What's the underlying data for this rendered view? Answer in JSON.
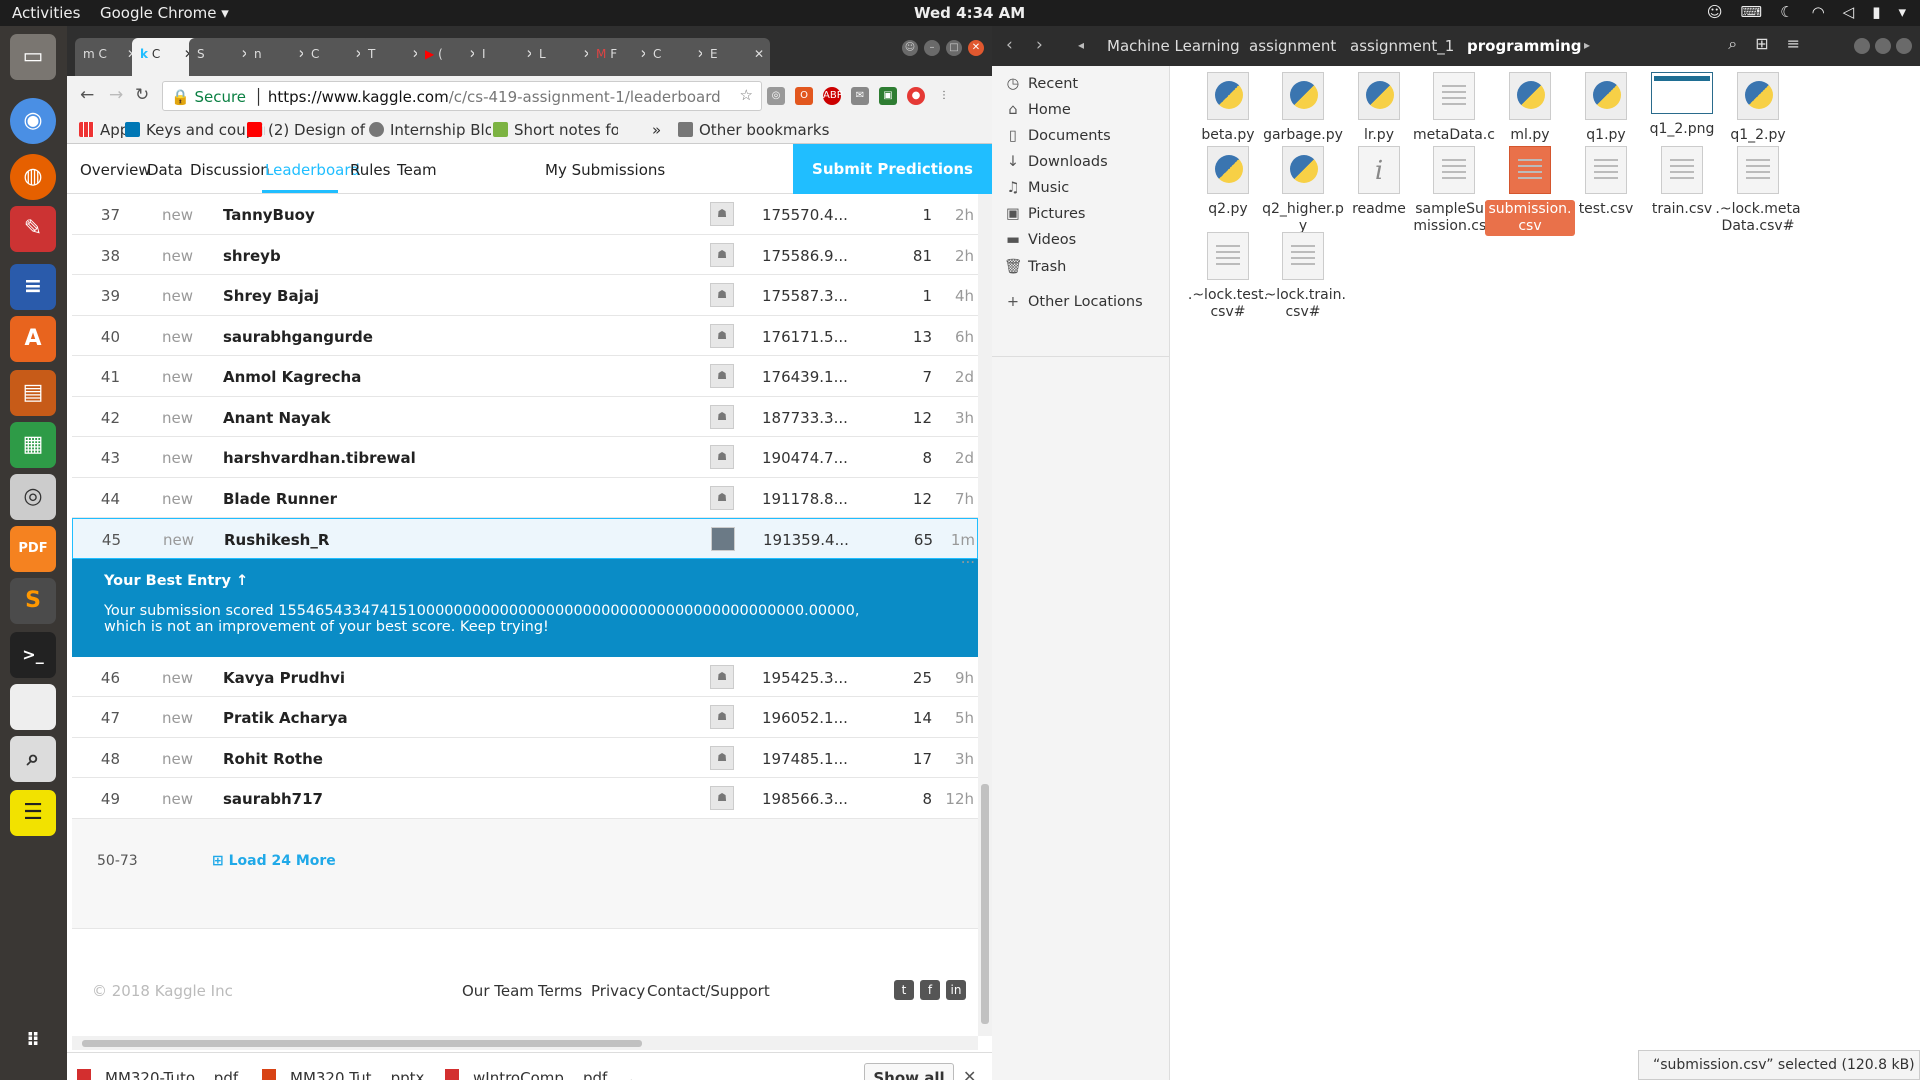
{
  "topbar": {
    "activities": "Activities",
    "app": "Google Chrome ▾",
    "clock": "Wed  4:34 AM"
  },
  "browser": {
    "tabs": [
      {
        "label": "C",
        "icon": "m"
      },
      {
        "label": "C",
        "icon": "k"
      },
      {
        "label": "S"
      },
      {
        "label": "n"
      },
      {
        "label": "C"
      },
      {
        "label": "T"
      },
      {
        "label": "("
      },
      {
        "label": "I"
      },
      {
        "label": "L"
      },
      {
        "label": "F"
      },
      {
        "label": "C"
      },
      {
        "label": "E"
      }
    ],
    "url": {
      "secure": "Secure",
      "host": "https://www.kaggle.com",
      "path": "/c/cs-419-assignment-1/leaderboard"
    },
    "bookmarks": [
      {
        "label": "Apps"
      },
      {
        "label": "Keys and couplin"
      },
      {
        "label": "(2) Design of Rig"
      },
      {
        "label": "Internship Blog -"
      },
      {
        "label": "Short notes for ("
      },
      {
        "label": "»"
      },
      {
        "label": "Other bookmarks"
      }
    ],
    "kaggle_nav": {
      "items": [
        "Overview",
        "Data",
        "Discussion",
        "Leaderboard",
        "Rules",
        "Team"
      ],
      "my_submissions": "My Submissions",
      "submit": "Submit Predictions"
    },
    "leaderboard_top": [
      {
        "rank": "37",
        "status": "new",
        "name": "TannyBuoy",
        "score": "175570.4...",
        "entries": "1",
        "last": "2h"
      },
      {
        "rank": "38",
        "status": "new",
        "name": "shreyb",
        "score": "175586.9...",
        "entries": "81",
        "last": "2h"
      },
      {
        "rank": "39",
        "status": "new",
        "name": "Shrey Bajaj",
        "score": "175587.3...",
        "entries": "1",
        "last": "4h"
      },
      {
        "rank": "40",
        "status": "new",
        "name": "saurabhgangurde",
        "score": "176171.5...",
        "entries": "13",
        "last": "6h"
      },
      {
        "rank": "41",
        "status": "new",
        "name": "Anmol Kagrecha",
        "score": "176439.1...",
        "entries": "7",
        "last": "2d"
      },
      {
        "rank": "42",
        "status": "new",
        "name": "Anant Nayak",
        "score": "187733.3...",
        "entries": "12",
        "last": "3h"
      },
      {
        "rank": "43",
        "status": "new",
        "name": "harshvardhan.tibrewal",
        "score": "190474.7...",
        "entries": "8",
        "last": "2d"
      },
      {
        "rank": "44",
        "status": "new",
        "name": "Blade Runner",
        "score": "191178.8...",
        "entries": "12",
        "last": "7h"
      }
    ],
    "my_row": {
      "rank": "45",
      "status": "new",
      "name": "Rushikesh_R",
      "score": "191359.4...",
      "entries": "65",
      "last": "1m ..."
    },
    "best_entry": {
      "title": "Your Best Entry ↑",
      "line1": "Your submission scored 155465433474151000000000000000000000000000000000000000000.00000,",
      "line2": "which is not an improvement of your best score. Keep trying!"
    },
    "leaderboard_bottom": [
      {
        "rank": "46",
        "status": "new",
        "name": "Kavya Prudhvi",
        "score": "195425.3...",
        "entries": "25",
        "last": "9h"
      },
      {
        "rank": "47",
        "status": "new",
        "name": "Pratik Acharya",
        "score": "196052.1...",
        "entries": "14",
        "last": "5h"
      },
      {
        "rank": "48",
        "status": "new",
        "name": "Rohit Rothe",
        "score": "197485.1...",
        "entries": "17",
        "last": "3h"
      },
      {
        "rank": "49",
        "status": "new",
        "name": "saurabh717",
        "score": "198566.3...",
        "entries": "8",
        "last": "12h"
      }
    ],
    "load_more": {
      "range": "50-73",
      "label": "Load 24 More"
    },
    "footer": {
      "copyright": "© 2018 Kaggle Inc",
      "links": [
        "Our Team",
        "Terms",
        "Privacy",
        "Contact/Support"
      ]
    },
    "downloads": [
      {
        "name": "MM320-Tuto....pdf"
      },
      {
        "name": "MM320 Tut....pptx"
      },
      {
        "name": "wIntroComp....pdf"
      }
    ],
    "show_all": "Show all"
  },
  "files": {
    "breadcrumbs": [
      "Machine Learning",
      "assignment",
      "assignment_1",
      "programming"
    ],
    "sidebar": [
      {
        "label": "Recent",
        "icon": "◷"
      },
      {
        "label": "Home",
        "icon": "⌂"
      },
      {
        "label": "Documents",
        "icon": "▯"
      },
      {
        "label": "Downloads",
        "icon": "↓"
      },
      {
        "label": "Music",
        "icon": "♫"
      },
      {
        "label": "Pictures",
        "icon": "▣"
      },
      {
        "label": "Videos",
        "icon": "▬"
      },
      {
        "label": "Trash",
        "icon": "🗑"
      },
      {
        "label": "Other Locations",
        "icon": "+"
      }
    ],
    "items": [
      {
        "name": "beta.py",
        "type": "py"
      },
      {
        "name": "garbage.py",
        "type": "py"
      },
      {
        "name": "lr.py",
        "type": "py"
      },
      {
        "name": "metaData.csv",
        "type": "doc"
      },
      {
        "name": "ml.py",
        "type": "py"
      },
      {
        "name": "q1.py",
        "type": "py"
      },
      {
        "name": "q1_2.png",
        "type": "png"
      },
      {
        "name": "q1_2.py",
        "type": "py"
      },
      {
        "name": "q2.py",
        "type": "py"
      },
      {
        "name": "q2_higher.py",
        "type": "py"
      },
      {
        "name": "readme",
        "type": "info"
      },
      {
        "name": "sampleSubmission.csv",
        "type": "doc"
      },
      {
        "name": "submission.csv",
        "type": "sel"
      },
      {
        "name": "test.csv",
        "type": "doc"
      },
      {
        "name": "train.csv",
        "type": "doc"
      },
      {
        "name": ".~lock.metaData.csv#",
        "type": "doc"
      },
      {
        "name": ".~lock.test.csv#",
        "type": "doc"
      },
      {
        "name": ".~lock.train.csv#",
        "type": "doc"
      }
    ],
    "status": "“submission.csv” selected  (120.8 kB)"
  }
}
